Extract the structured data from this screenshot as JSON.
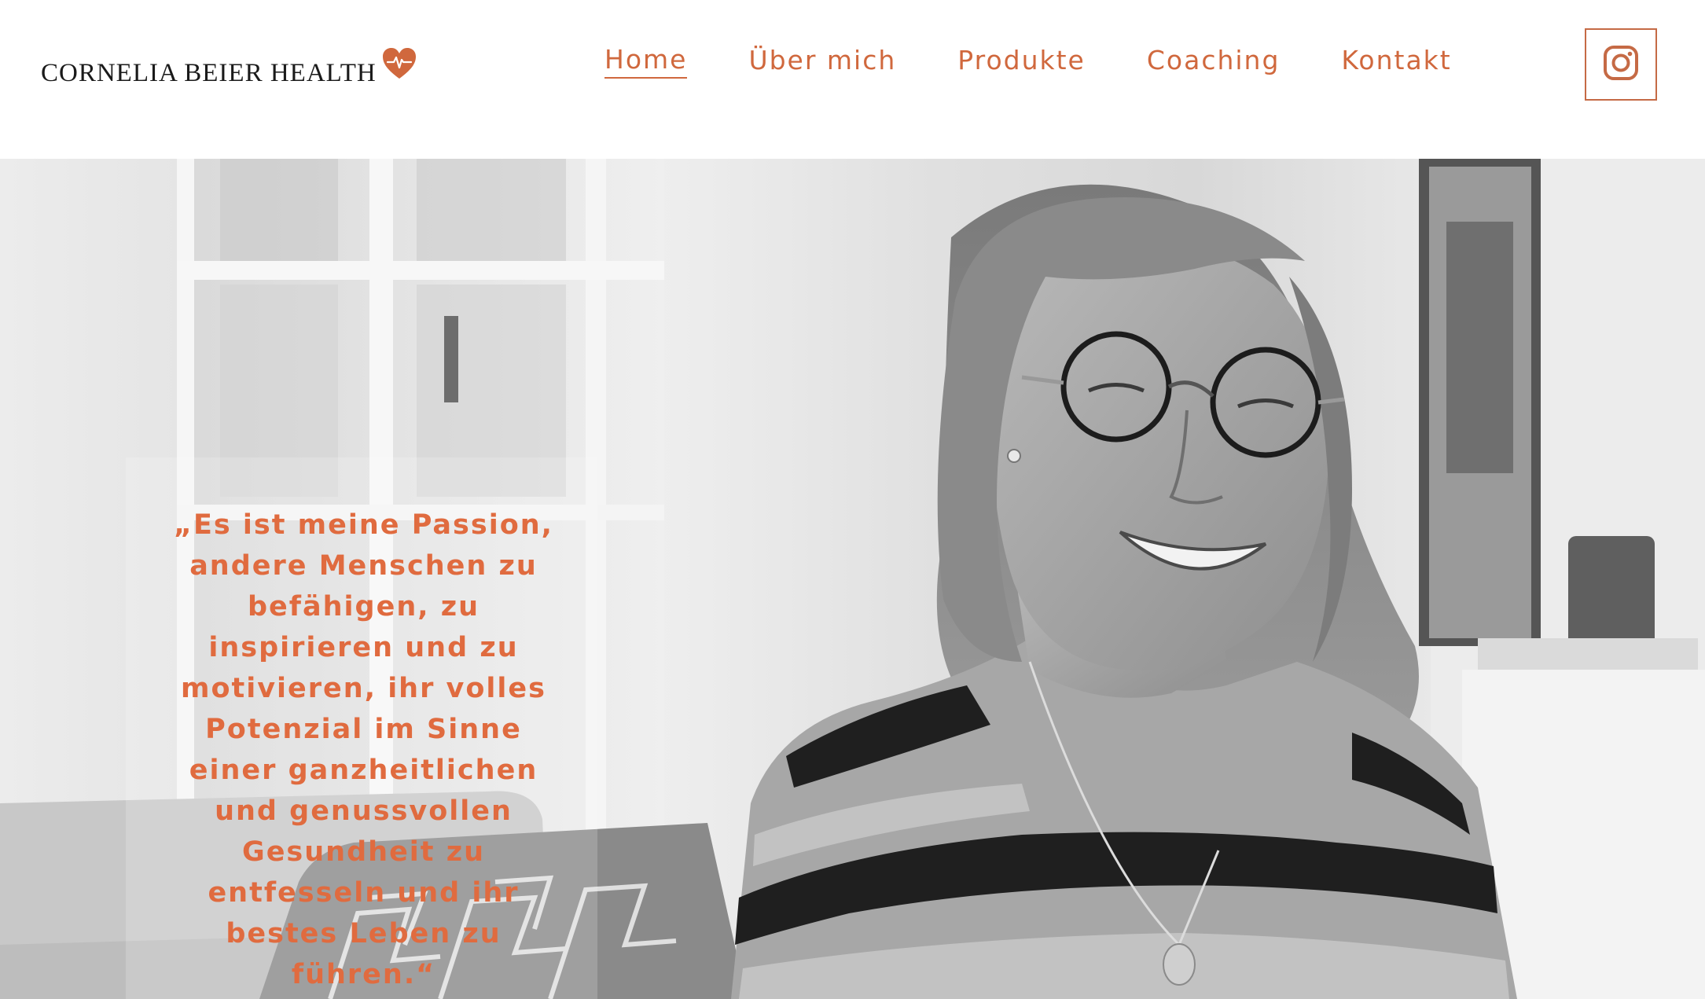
{
  "brand": {
    "logo_text": "CORNELIA BEIER HEALTH",
    "logo_icon": "heart-pulse-icon"
  },
  "nav": {
    "items": [
      {
        "label": "Home",
        "active": true
      },
      {
        "label": "Über mich",
        "active": false
      },
      {
        "label": "Produkte",
        "active": false
      },
      {
        "label": "Coaching",
        "active": false
      },
      {
        "label": "Kontakt",
        "active": false
      }
    ]
  },
  "social": {
    "icon": "instagram-icon"
  },
  "hero": {
    "quote": "„Es ist meine Passion, andere Menschen zu befähigen, zu inspirieren und zu motivieren, ihr volles Potenzial im Sinne einer ganzheitlichen und genussvollen Gesundheit zu entfesseln und ihr bestes Leben zu führen.“",
    "image": "portrait-photo-black-and-white"
  },
  "colors": {
    "accent": "#d0683d",
    "quote": "#e06b3f",
    "text_dark": "#1a1a1a",
    "background": "#ffffff"
  }
}
